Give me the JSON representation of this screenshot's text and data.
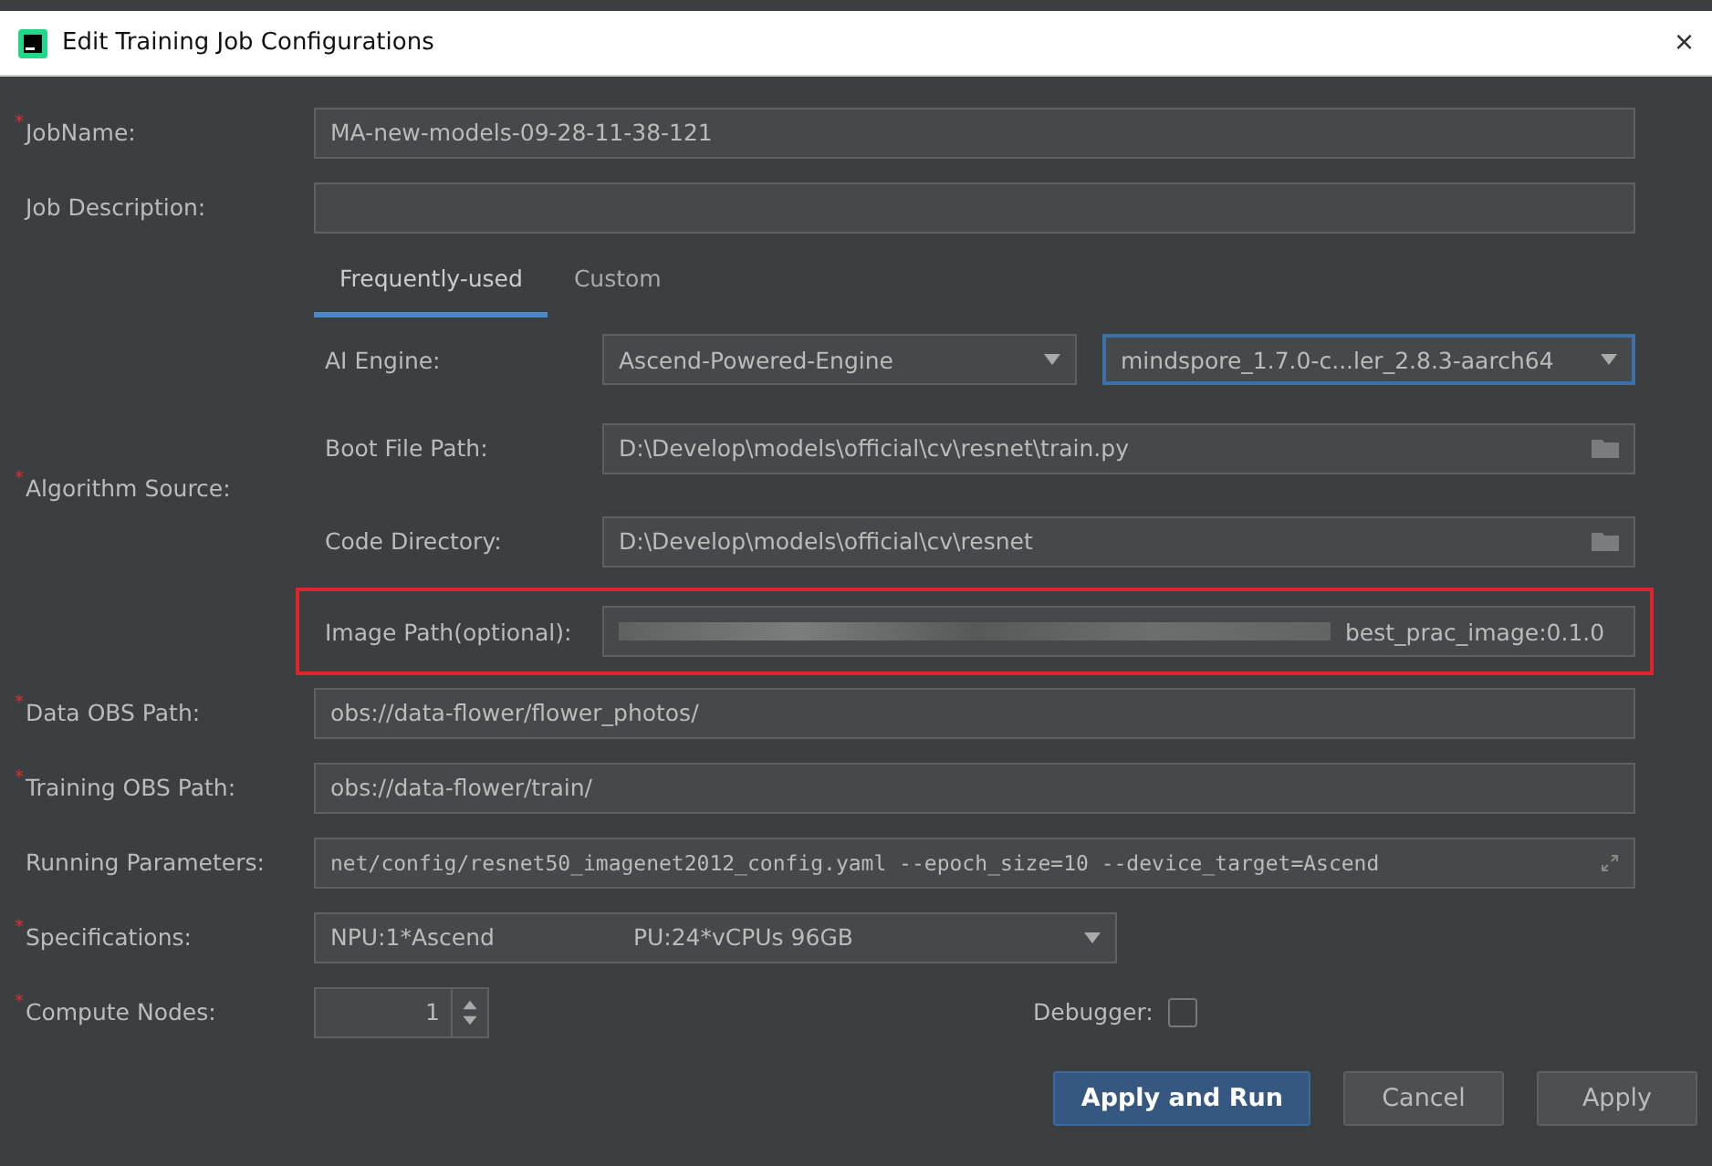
{
  "window": {
    "title": "Edit Training Job Configurations",
    "close": "×"
  },
  "top_fields": [
    {
      "label": "JobName:",
      "required": true,
      "value": "MA-new-models-09-28-11-38-121"
    },
    {
      "label": "Job Description:",
      "required": false
    }
  ],
  "tabs": [
    {
      "label": "Frequently-used",
      "selected": true
    },
    {
      "label": "Custom",
      "selected": false
    }
  ],
  "ai_engine": {
    "label": "AI Engine:",
    "engine": "Ascend-Powered-Engine",
    "version": "mindspore_1.7.0-c...ler_2.8.3-aarch64",
    "version_focused": true
  },
  "algorithm_source": {
    "label": "Algorithm Source:",
    "required": true,
    "fields": [
      {
        "label": "Boot File Path:",
        "value": "D:\\Develop\\models\\official\\cv\\resnet\\train.py",
        "kind": "file",
        "highlighted": false
      },
      {
        "label": "Code Directory:",
        "value": "D:\\Develop\\models\\official\\cv\\resnet",
        "kind": "file",
        "highlighted": false
      },
      {
        "label": "Image Path(optional):",
        "value": "best_prac_image:0.1.0",
        "kind": "redacted",
        "highlighted": true
      }
    ]
  },
  "fields": [
    {
      "label": "Data OBS Path:",
      "required": true,
      "value": "obs://data-flower/flower_photos/",
      "kind": "text"
    },
    {
      "label": "Training OBS Path:",
      "required": true,
      "value": "obs://data-flower/train/",
      "kind": "text"
    },
    {
      "label": "Running Parameters:",
      "required": false,
      "value": "net/config/resnet50_imagenet2012_config.yaml --epoch_size=10 --device_target=Ascend",
      "kind": "code"
    },
    {
      "label": "Specifications:",
      "required": true,
      "value": "NPU:1*Ascend",
      "value_2": "PU:24*vCPUs 96GB",
      "kind": "select"
    }
  ],
  "compute_nodes": {
    "label": "Compute Nodes:",
    "required": true,
    "value": "1"
  },
  "debugger": {
    "label": "Debugger:",
    "checked": false
  },
  "required_mark": "*",
  "buttons": [
    {
      "label": "Apply and Run",
      "primary": true
    },
    {
      "label": "Cancel",
      "primary": false
    },
    {
      "label": "Apply",
      "primary": false
    }
  ]
}
